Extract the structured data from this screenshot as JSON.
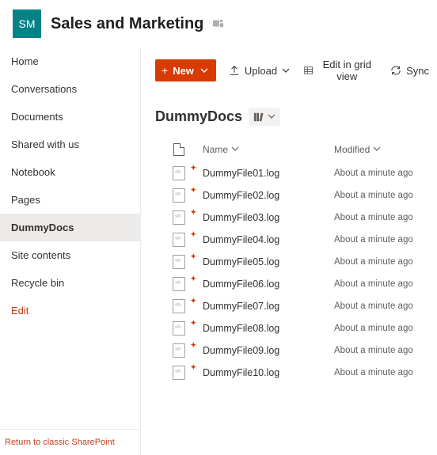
{
  "site": {
    "logo_initials": "SM",
    "title": "Sales and Marketing"
  },
  "sidebar": {
    "items": [
      {
        "label": "Home"
      },
      {
        "label": "Conversations"
      },
      {
        "label": "Documents"
      },
      {
        "label": "Shared with us"
      },
      {
        "label": "Notebook"
      },
      {
        "label": "Pages"
      },
      {
        "label": "DummyDocs"
      },
      {
        "label": "Site contents"
      },
      {
        "label": "Recycle bin"
      },
      {
        "label": "Edit"
      }
    ],
    "active_index": 6,
    "footer": "Return to classic SharePoint"
  },
  "toolbar": {
    "new_label": "New",
    "upload_label": "Upload",
    "edit_grid_label": "Edit in grid view",
    "sync_label": "Sync"
  },
  "library": {
    "title": "DummyDocs",
    "columns": {
      "name": "Name",
      "modified": "Modified"
    },
    "files": [
      {
        "name": "DummyFile01.log",
        "modified": "About a minute ago"
      },
      {
        "name": "DummyFile02.log",
        "modified": "About a minute ago"
      },
      {
        "name": "DummyFile03.log",
        "modified": "About a minute ago"
      },
      {
        "name": "DummyFile04.log",
        "modified": "About a minute ago"
      },
      {
        "name": "DummyFile05.log",
        "modified": "About a minute ago"
      },
      {
        "name": "DummyFile06.log",
        "modified": "About a minute ago"
      },
      {
        "name": "DummyFile07.log",
        "modified": "About a minute ago"
      },
      {
        "name": "DummyFile08.log",
        "modified": "About a minute ago"
      },
      {
        "name": "DummyFile09.log",
        "modified": "About a minute ago"
      },
      {
        "name": "DummyFile10.log",
        "modified": "About a minute ago"
      }
    ]
  }
}
